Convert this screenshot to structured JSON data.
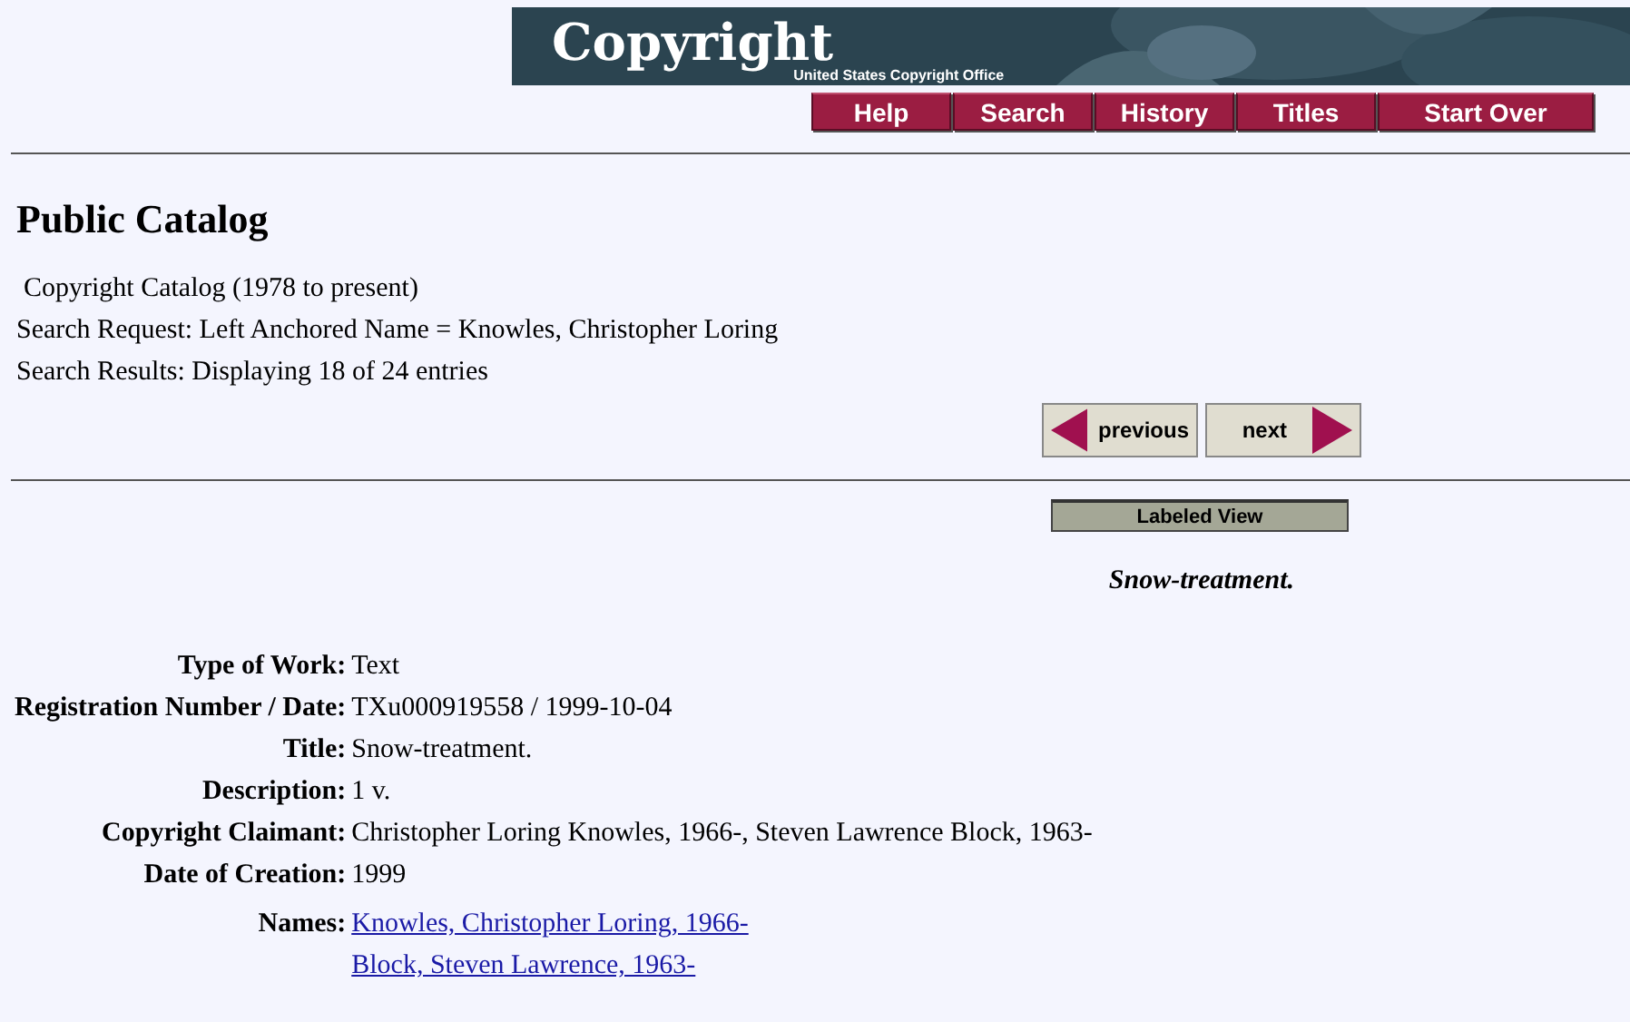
{
  "banner": {
    "logo": "Copyright",
    "subtitle": "United States Copyright Office"
  },
  "nav": [
    "Help",
    "Search",
    "History",
    "Titles",
    "Start Over"
  ],
  "heading": "Public Catalog",
  "info": [
    "Copyright Catalog (1978 to present)",
    "Search Request: Left Anchored Name = Knowles, Christopher Loring",
    "Search Results: Displaying 18 of 24 entries"
  ],
  "pager": {
    "previous": "previous",
    "next": "next"
  },
  "view_button": "Labeled View",
  "record_title": "Snow-treatment.",
  "fields": [
    {
      "kind": "text",
      "label": "Type of Work:",
      "value": "Text"
    },
    {
      "kind": "text",
      "label": "Registration Number / Date:",
      "value": "TXu000919558 / 1999-10-04"
    },
    {
      "kind": "text",
      "label": "Title:",
      "value": "Snow-treatment."
    },
    {
      "kind": "text",
      "label": "Description:",
      "value": "1 v."
    },
    {
      "kind": "text",
      "label": "Copyright Claimant:",
      "value": "Christopher Loring Knowles, 1966-, Steven Lawrence Block, 1963-"
    },
    {
      "kind": "text",
      "label": "Date of Creation:",
      "value": "1999"
    },
    {
      "kind": "links",
      "label": "Names:",
      "links": [
        "Knowles, Christopher Loring, 1966-",
        "Block, Steven Lawrence, 1963-"
      ]
    }
  ]
}
